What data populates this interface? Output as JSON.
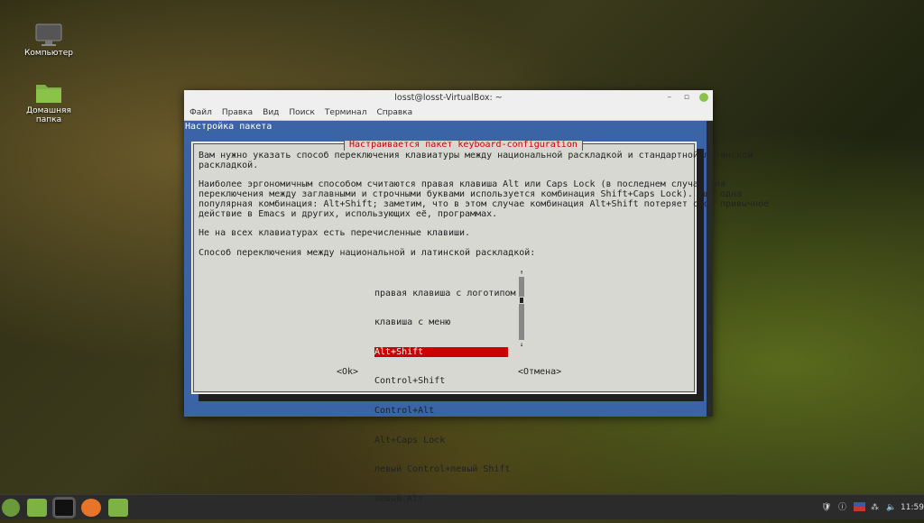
{
  "desktop": {
    "icons": [
      {
        "label": "Компьютер",
        "icon": "computer-icon"
      },
      {
        "label": "Домашняя папка",
        "icon": "folder-icon"
      }
    ]
  },
  "terminal": {
    "title": "losst@losst-VirtualBox: ~",
    "menu": [
      "Файл",
      "Правка",
      "Вид",
      "Поиск",
      "Терминал",
      "Справка"
    ],
    "backtitle": "Настройка пакета",
    "dialog": {
      "title": "Настраивается пакет keyboard-configuration",
      "text": "Вам нужно указать способ переключения клавиатуры между национальной раскладкой и стандартной латинской\nраскладкой.\n\nНаиболее эргономичным способом считаются правая клавиша Alt или Caps Lock (в последнем случае для\nпереключения между заглавными и строчными буквами используется комбинация Shift+Caps Lock). Ещё одна\nпопулярная комбинация: Alt+Shift; заметим, что в этом случае комбинация Alt+Shift потеряет своё привычное\nдействие в Emacs и других, использующих её, программах.\n\nНе на всех клавиатурах есть перечисленные клавиши.\n\nСпособ переключения между национальной и латинской раскладкой:",
      "options": [
        "правая клавиша с логотипом",
        "клавиша с меню",
        "Alt+Shift",
        "Control+Shift",
        "Control+Alt",
        "Alt+Caps Lock",
        "левый Control+левый Shift",
        "левый Alt"
      ],
      "selected_index": 2,
      "scroll_up": "↑",
      "scroll_down": "↓",
      "ok": "<Ok>",
      "cancel": "<Отмена>"
    }
  },
  "taskbar": {
    "clock": "11:59",
    "tray": [
      "shield-icon",
      "update-icon",
      "us-flag-icon",
      "network-icon",
      "volume-icon"
    ]
  },
  "colors": {
    "terminal_bg": "#3b64a6",
    "dialog_bg": "#d8d8d3",
    "highlight": "#cc0000"
  }
}
